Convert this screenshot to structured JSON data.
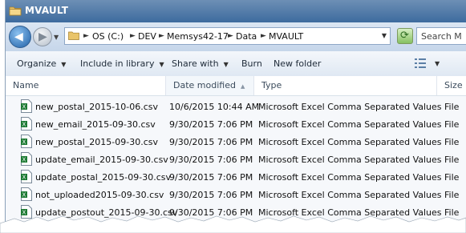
{
  "window": {
    "title": "MVAULT"
  },
  "address": {
    "crumbs": [
      "OS (C:)",
      "DEV",
      "Memsys42-17",
      "Data",
      "MVAULT"
    ]
  },
  "search": {
    "placeholder": "Search M"
  },
  "toolbar": {
    "organize": "Organize",
    "include_in_library": "Include in library",
    "share_with": "Share with",
    "burn": "Burn",
    "new_folder": "New folder"
  },
  "columns": {
    "name": "Name",
    "date_modified": "Date modified",
    "type": "Type",
    "size": "Size"
  },
  "files": [
    {
      "name": "new_postal_2015-10-06.csv",
      "date": "10/6/2015 10:44 AM",
      "type": "Microsoft Excel Comma Separated Values File"
    },
    {
      "name": "new_email_2015-09-30.csv",
      "date": "9/30/2015 7:06 PM",
      "type": "Microsoft Excel Comma Separated Values File"
    },
    {
      "name": "new_postal_2015-09-30.csv",
      "date": "9/30/2015 7:06 PM",
      "type": "Microsoft Excel Comma Separated Values File"
    },
    {
      "name": "update_email_2015-09-30.csv",
      "date": "9/30/2015 7:06 PM",
      "type": "Microsoft Excel Comma Separated Values File"
    },
    {
      "name": "update_postal_2015-09-30.csv",
      "date": "9/30/2015 7:06 PM",
      "type": "Microsoft Excel Comma Separated Values File"
    },
    {
      "name": "not_uploaded2015-09-30.csv",
      "date": "9/30/2015 7:06 PM",
      "type": "Microsoft Excel Comma Separated Values File"
    },
    {
      "name": "update_postout_2015-09-30.csv",
      "date": "9/30/2015 7:06 PM",
      "type": "Microsoft Excel Comma Separated Values File"
    }
  ],
  "icons": {
    "title": "folder-icon",
    "file": "excel-csv-icon",
    "back": "back-arrow-icon",
    "forward": "forward-arrow-icon",
    "refresh": "refresh-icon",
    "view": "view-options-icon"
  },
  "colors": {
    "titlebar": "#3d6b9e",
    "excel_green": "#1e7b34"
  }
}
